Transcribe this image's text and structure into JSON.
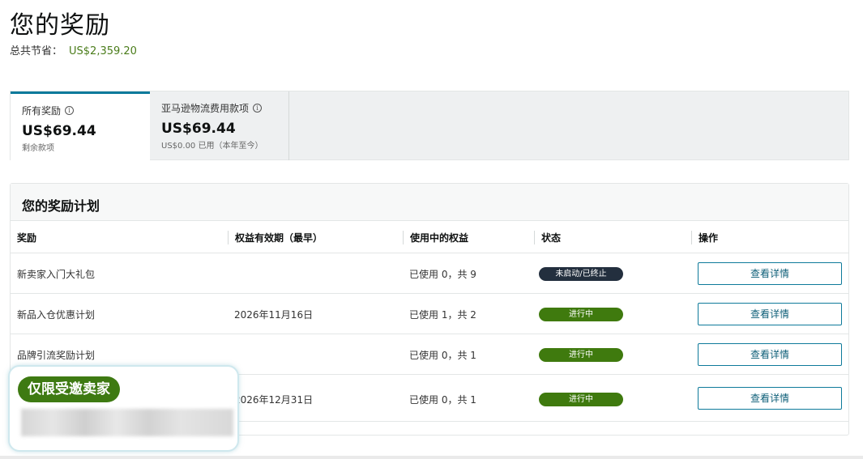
{
  "page": {
    "title": "您的奖励",
    "savings_label": "总共节省：",
    "savings_amount": "US$2,359.20"
  },
  "tabs": [
    {
      "label": "所有奖励",
      "amount": "US$69.44",
      "sub": "剩余款项",
      "info_icon": "info-icon"
    },
    {
      "label": "亚马逊物流费用款项",
      "amount": "US$69.44",
      "sub": "US$0.00 已用（本年至今）",
      "info_icon": "info-icon"
    }
  ],
  "plans": {
    "heading": "您的奖励计划",
    "columns": [
      "奖励",
      "权益有效期（最早）",
      "使用中的权益",
      "状态",
      "操作"
    ],
    "rows": [
      {
        "name": "新卖家入门大礼包",
        "expiry": "",
        "usage": "已使用 0，共 9",
        "status": "未启动/已终止",
        "action": "查看详情"
      },
      {
        "name": "新品入仓优惠计划",
        "expiry": "2026年11月16日",
        "usage": "已使用 1，共 2",
        "status": "进行中",
        "action": "查看详情"
      },
      {
        "name": "品牌引流奖励计划",
        "expiry": "",
        "usage": "已使用 0，共 1",
        "status": "进行中",
        "action": "查看详情"
      },
      {
        "name": "",
        "expiry": "2026年12月31日",
        "usage": "已使用 0，共 1",
        "status": "进行中",
        "action": "查看详情"
      }
    ]
  },
  "overlay": {
    "badge": "仅限受邀卖家"
  },
  "colors": {
    "accent_tab": "#0b7a9b",
    "savings_green": "#4a7c1a",
    "status_active": "#3f7a0e",
    "status_stopped": "#232f3e",
    "button_border": "#0e7a9a"
  }
}
